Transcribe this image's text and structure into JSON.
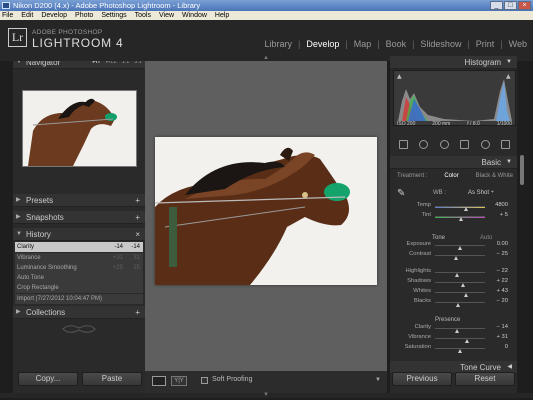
{
  "window": {
    "title": "Nikon D200 (4.x) - Adobe Photoshop Lightroom - Library"
  },
  "menu": [
    "File",
    "Edit",
    "Develop",
    "Photo",
    "Settings",
    "Tools",
    "View",
    "Window",
    "Help"
  ],
  "brand": {
    "badge": "Lr",
    "small": "ADOBE PHOTOSHOP",
    "big": "LIGHTROOM 4"
  },
  "modules": [
    "Library",
    "Develop",
    "Map",
    "Book",
    "Slideshow",
    "Print",
    "Web"
  ],
  "left": {
    "navigator": {
      "title": "Navigator",
      "zoom": [
        "FIT",
        "FILL",
        "1:1",
        "3:1"
      ]
    },
    "presets": "Presets",
    "snapshots": "Snapshots",
    "history": "History",
    "collections": "Collections",
    "history_items": [
      {
        "label": "Clarity",
        "v1": "-14",
        "v2": "-14"
      },
      {
        "label": "Vibrance",
        "v1": "+31",
        "v2": "31"
      },
      {
        "label": "Luminance Smoothing",
        "v1": "+25",
        "v2": "25"
      },
      {
        "label": "Auto Tone",
        "v1": "",
        "v2": ""
      },
      {
        "label": "Crop Rectangle",
        "v1": "",
        "v2": ""
      },
      {
        "label": "Import (7/27/2012 10:04:47 PM)",
        "v1": "",
        "v2": ""
      }
    ],
    "copy": "Copy...",
    "paste": "Paste"
  },
  "toolbar": {
    "soft_proofing": "Soft Proofing"
  },
  "right": {
    "histogram": "Histogram",
    "histo_info": [
      "ISO 200",
      "200 mm",
      "f / 8.0",
      "1/1000"
    ],
    "basic": "Basic",
    "treatment": {
      "label": "Treatment :",
      "color": "Color",
      "bw": "Black & White"
    },
    "wb": {
      "label": "WB :",
      "value": "As Shot ÷"
    },
    "temp": {
      "label": "Temp",
      "value": "4800"
    },
    "tint": {
      "label": "Tint",
      "value": "+ 5"
    },
    "tone": "Tone",
    "auto": "Auto",
    "exposure": {
      "label": "Exposure",
      "value": "0.00"
    },
    "contrast": {
      "label": "Contrast",
      "value": "− 25"
    },
    "highlights": {
      "label": "Highlights",
      "value": "− 22"
    },
    "shadows": {
      "label": "Shadows",
      "value": "+ 22"
    },
    "whites": {
      "label": "Whites",
      "value": "+ 43"
    },
    "blacks": {
      "label": "Blacks",
      "value": "− 20"
    },
    "presence": "Presence",
    "clarity": {
      "label": "Clarity",
      "value": "− 14"
    },
    "vibrance": {
      "label": "Vibrance",
      "value": "+ 31"
    },
    "saturation": {
      "label": "Saturation",
      "value": "0"
    },
    "tone_curve": "Tone Curve",
    "previous": "Previous",
    "reset": "Reset"
  }
}
